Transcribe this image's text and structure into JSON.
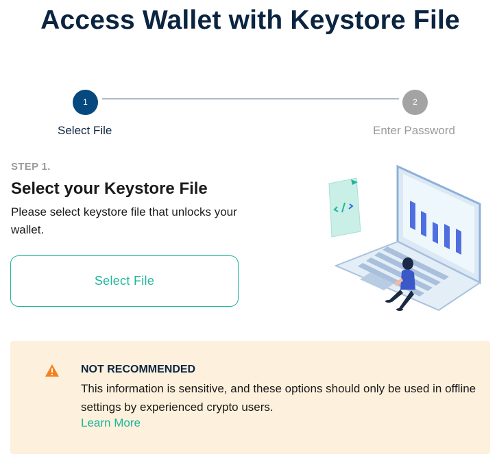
{
  "page": {
    "title": "Access Wallet with Keystore File"
  },
  "stepper": {
    "steps": [
      {
        "number": "1",
        "label": "Select File",
        "state": "active"
      },
      {
        "number": "2",
        "label": "Enter Password",
        "state": "inactive"
      }
    ]
  },
  "main": {
    "eyebrow": "STEP 1.",
    "title": "Select your Keystore File",
    "description": "Please select keystore file that unlocks your wallet.",
    "select_button_label": "Select File",
    "illustration_icon": "laptop-person-illustration"
  },
  "warning": {
    "icon": "warning-triangle-icon",
    "title": "NOT RECOMMENDED",
    "text": "This information is sensitive, and these options should only be used in offline settings by experienced crypto users.",
    "link_label": "Learn More"
  },
  "colors": {
    "accent": "#1fb59a",
    "primary_dark": "#0b2440",
    "step_active": "#06497f",
    "step_inactive": "#a3a3a3",
    "warning_bg": "#fdf0dc",
    "warning_icon": "#f5821f"
  }
}
